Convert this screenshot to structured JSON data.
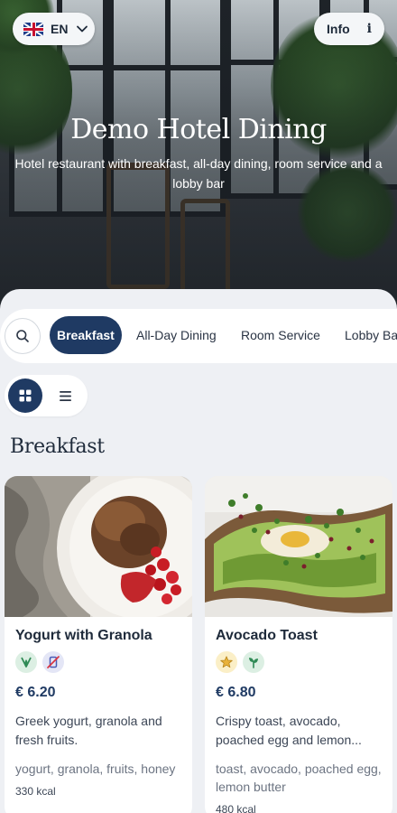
{
  "header": {
    "language": "EN",
    "info_label": "Info",
    "info_symbol": "i",
    "title": "Demo Hotel Dining",
    "subtitle": "Hotel restaurant with breakfast, all-day dining, room service and a lobby bar"
  },
  "tabs": [
    {
      "label": "Breakfast",
      "active": true
    },
    {
      "label": "All-Day Dining",
      "active": false
    },
    {
      "label": "Room Service",
      "active": false
    },
    {
      "label": "Lobby Bar",
      "active": false
    }
  ],
  "view_toggle": {
    "selected": "grid",
    "grid_icon": "grid-icon",
    "list_icon": "list-icon"
  },
  "section": {
    "title": "Breakfast"
  },
  "items": [
    {
      "name": "Yogurt with Granola",
      "badges": [
        "vegetarian-icon",
        "no-gluten-icon"
      ],
      "price": "€ 6.20",
      "description": "Greek yogurt, granola and fresh fruits.",
      "tags": "yogurt, granola, fruits, honey",
      "kcal": "330 kcal"
    },
    {
      "name": "Avocado Toast",
      "badges": [
        "star-icon",
        "vegan-icon"
      ],
      "price": "€ 6.80",
      "description": "Crispy toast, avocado, poached egg and lemon...",
      "tags": "toast, avocado, poached egg, lemon butter",
      "kcal": "480 kcal"
    }
  ],
  "colors": {
    "accent": "#1f3a63",
    "background": "#eef0f4",
    "card": "#ffffff"
  }
}
